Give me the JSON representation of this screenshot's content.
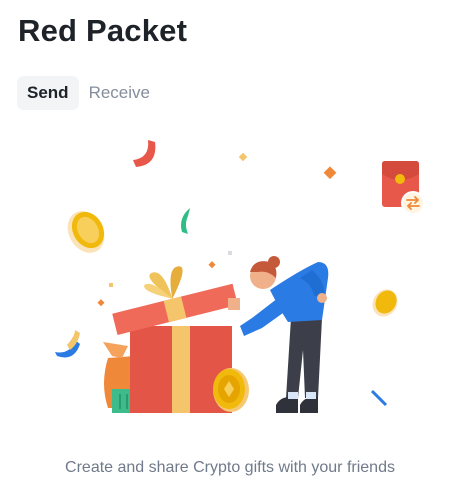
{
  "page": {
    "title": "Red Packet"
  },
  "tabs": [
    {
      "label": "Send",
      "active": true
    },
    {
      "label": "Receive",
      "active": false
    }
  ],
  "empty_state": {
    "caption": "Create and share Crypto gifts with your friends",
    "illustration": "gift-box-person-illustration"
  },
  "colors": {
    "title": "#1e2329",
    "tab_active_bg": "#f3f4f5",
    "tab_inactive_text": "#848e9c",
    "caption_text": "#707a8a",
    "gift_red": "#e8584a",
    "gold": "#f0b90b",
    "person_blue": "#2b7be4"
  }
}
